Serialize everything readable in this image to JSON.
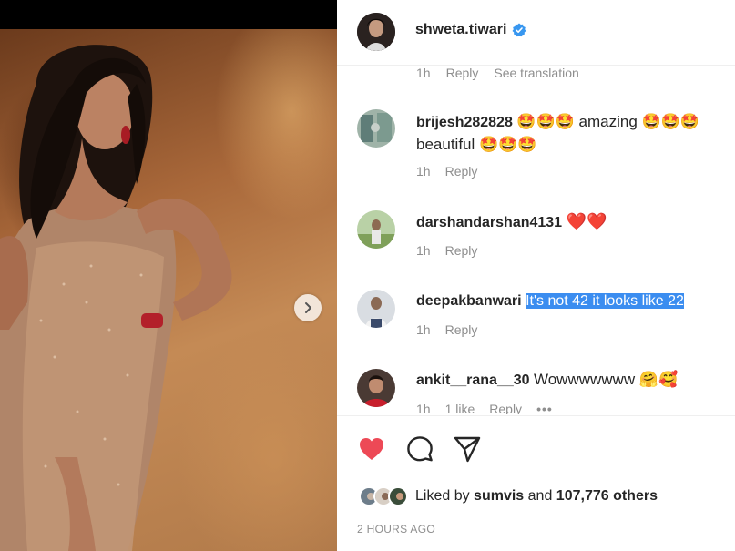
{
  "post": {
    "username": "shweta.tiwari",
    "verified": true
  },
  "partial_comment_meta": {
    "time": "1h",
    "reply": "Reply",
    "translate": "See translation"
  },
  "comments": [
    {
      "username": "brijesh282828",
      "text_line1": "🤩🤩🤩 amazing 🤩🤩🤩",
      "text_line2": "beautiful 🤩🤩🤩",
      "time": "1h",
      "reply": "Reply"
    },
    {
      "username": "darshandarshan4131",
      "text": "❤️❤️",
      "time": "1h",
      "reply": "Reply"
    },
    {
      "username": "deepakbanwari",
      "text": "It's not 42 it looks like 22",
      "selected": true,
      "time": "1h",
      "reply": "Reply"
    },
    {
      "username": "ankit__rana__30",
      "text": "Wowwwwwww 🤗🥰",
      "time": "1h",
      "likes": "1 like",
      "reply": "Reply",
      "more": "•••"
    }
  ],
  "actions": {
    "like_icon": "heart-filled-icon",
    "comment_icon": "comment-bubble-icon",
    "share_icon": "paper-plane-icon",
    "like_color": "#ed4956"
  },
  "likes": {
    "prefix": "Liked by",
    "first_user": "sumvis",
    "connector": "and",
    "others": "107,776 others"
  },
  "timestamp": "2 HOURS AGO",
  "media": {
    "next_icon": "chevron-right-icon"
  }
}
